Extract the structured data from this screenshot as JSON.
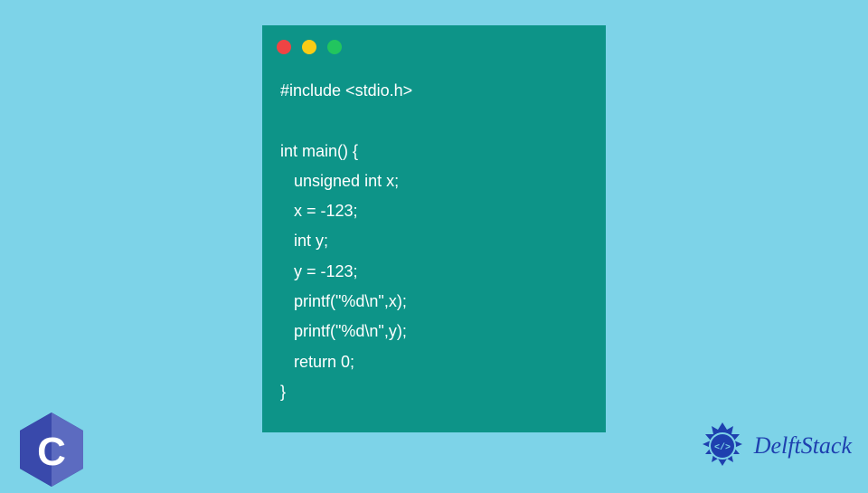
{
  "code": {
    "line1": "#include <stdio.h>",
    "line2": "",
    "line3": "int main() {",
    "line4": "   unsigned int x;",
    "line5": "   x = -123;",
    "line6": "   int y;",
    "line7": "   y = -123;",
    "line8": "   printf(\"%d\\n\",x);",
    "line9": "   printf(\"%d\\n\",y);",
    "line10": "   return 0;",
    "line11": "}"
  },
  "branding": {
    "delft_name": "DelftStack"
  },
  "colors": {
    "background": "#7dd3e8",
    "code_window": "#0d9488",
    "code_text": "#ffffff",
    "c_logo": "#1e3a8a",
    "delft_blue": "#1e40af"
  }
}
